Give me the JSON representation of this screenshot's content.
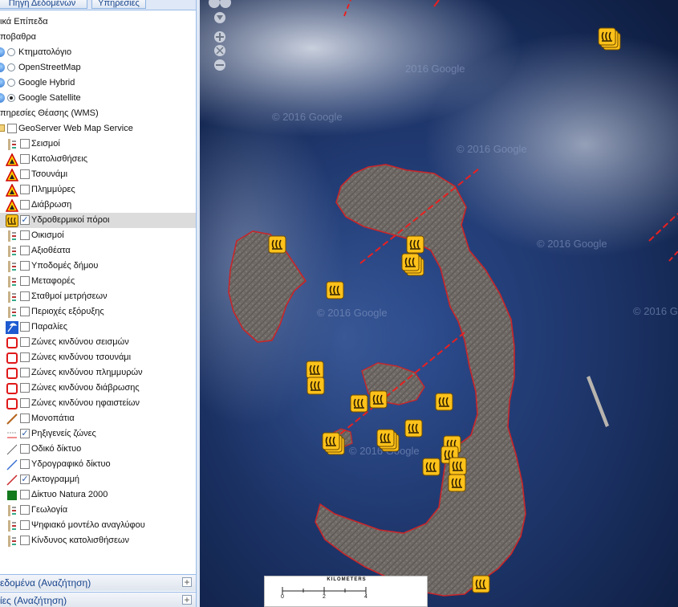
{
  "tabs": [
    {
      "label": "Πηγή Δεδομένων"
    },
    {
      "label": "Υπηρεσίες"
    }
  ],
  "tree": {
    "root_label": "ικά Επίπεδα",
    "base_group": "ποβαθρα",
    "base_layers": [
      {
        "label": "Κτηματολόγιο",
        "selected": false
      },
      {
        "label": "OpenStreetMap",
        "selected": false
      },
      {
        "label": "Google Hybrid",
        "selected": false
      },
      {
        "label": "Google Satellite",
        "selected": true
      }
    ],
    "wms_group": "πηρεσίες Θέασης (WMS)",
    "wms_service": "GeoServer Web Map Service",
    "layers": [
      {
        "label": "Σεισμοί",
        "checked": false,
        "icon": "seismic-legend-icon"
      },
      {
        "label": "Κατολισθήσεις",
        "checked": false,
        "icon": "landslide-warning-icon"
      },
      {
        "label": "Τσουνάμι",
        "checked": false,
        "icon": "tsunami-warning-icon"
      },
      {
        "label": "Πλημμύρες",
        "checked": false,
        "icon": "flood-warning-icon"
      },
      {
        "label": "Διάβρωση",
        "checked": false,
        "icon": "erosion-warning-icon"
      },
      {
        "label": "Υδροθερμικοί πόροι",
        "checked": true,
        "icon": "hot-spring-icon"
      },
      {
        "label": "Οικισμοί",
        "checked": false,
        "icon": "settlements-legend-icon"
      },
      {
        "label": "Αξιοθέατα",
        "checked": false,
        "icon": "sights-legend-icon"
      },
      {
        "label": "Υποδομές δήμου",
        "checked": false,
        "icon": "infrastructure-legend-icon"
      },
      {
        "label": "Μεταφορές",
        "checked": false,
        "icon": "transport-legend-icon"
      },
      {
        "label": "Σταθμοί μετρήσεων",
        "checked": false,
        "icon": "stations-legend-icon"
      },
      {
        "label": "Περιοχές εξόρυξης",
        "checked": false,
        "icon": "mining-legend-icon"
      },
      {
        "label": "Παραλίες",
        "checked": false,
        "icon": "beach-icon"
      },
      {
        "label": "Ζώνες κινδύνου σεισμών",
        "checked": false,
        "icon": "zone-outline-icon"
      },
      {
        "label": "Ζώνες κινδύνου τσουνάμι",
        "checked": false,
        "icon": "zone-outline-icon"
      },
      {
        "label": "Ζώνες κινδύνου πλημμυρών",
        "checked": false,
        "icon": "zone-outline-icon"
      },
      {
        "label": "Ζώνες κινδύνου διάβρωσης",
        "checked": false,
        "icon": "zone-outline-icon"
      },
      {
        "label": "Ζώνες κινδύνου ηφαιστείων",
        "checked": false,
        "icon": "zone-outline-icon"
      },
      {
        "label": "Μονοπάτια",
        "checked": false,
        "icon": "trail-line-icon"
      },
      {
        "label": "Ρηξιγενείς ζώνες",
        "checked": true,
        "icon": "fault-zone-icon"
      },
      {
        "label": "Οδικό δίκτυο",
        "checked": false,
        "icon": "road-line-icon"
      },
      {
        "label": "Υδρογραφικό δίκτυο",
        "checked": false,
        "icon": "hydro-line-icon"
      },
      {
        "label": "Ακτογραμμή",
        "checked": true,
        "icon": "coastline-icon"
      },
      {
        "label": "Δίκτυο Natura 2000",
        "checked": false,
        "icon": "natura-square-icon"
      },
      {
        "label": "Γεωλογία",
        "checked": false,
        "icon": "geology-legend-icon"
      },
      {
        "label": "Ψηφιακό μοντέλο αναγλύφου",
        "checked": false,
        "icon": "dem-legend-icon"
      },
      {
        "label": "Κίνδυνος κατολισθήσεων",
        "checked": false,
        "icon": "landslide-risk-icon"
      }
    ]
  },
  "panels": [
    {
      "label": "εδομένα (Αναζήτηση)"
    },
    {
      "label": "ίες (Αναζήτηση)"
    }
  ],
  "map": {
    "watermark": "© 2016 Google",
    "watermark_short": "2016 Google",
    "scalebar": {
      "title": "KILOMETERS",
      "ticks": [
        "0",
        "2",
        "4"
      ]
    },
    "markers_icon": "hot-spring-icon",
    "colors": {
      "sea": "#1b2f5e",
      "land": "#6e6a67",
      "coast": "#c8262a",
      "marker": "#ffc21a"
    }
  }
}
